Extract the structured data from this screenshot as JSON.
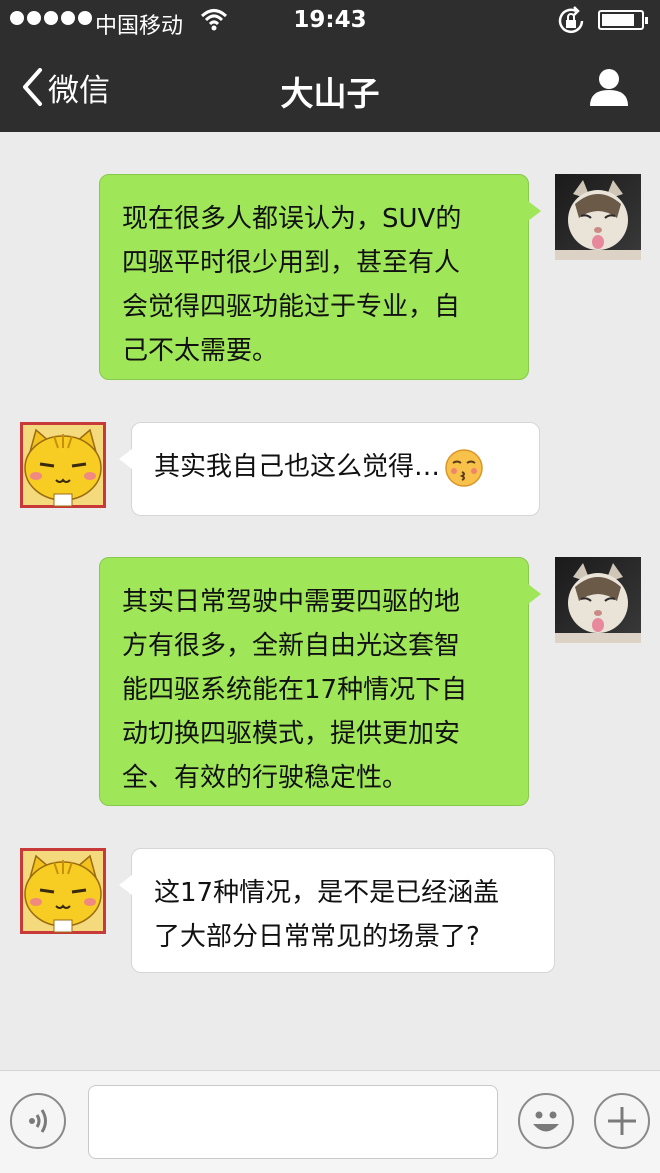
{
  "status_bar": {
    "carrier": "中国移动",
    "time": "19:43",
    "icons": [
      "signal-dots",
      "wifi-icon",
      "rotation-lock-icon",
      "battery-icon"
    ]
  },
  "nav": {
    "back_label": "微信",
    "title": "大山子",
    "right_icon": "profile-icon"
  },
  "messages": [
    {
      "sender": "me",
      "lines": [
        "现在很多人都误认为，SUV的",
        "四驱平时很少用到，甚至有人",
        "会觉得四驱功能过于专业，自",
        "己不太需要。"
      ],
      "avatar": "cat-photo"
    },
    {
      "sender": "other",
      "lines": [
        "其实我自己也这么觉得…"
      ],
      "emoji": "kissing-face-emoji",
      "avatar": "yellow-cartoon-cat"
    },
    {
      "sender": "me",
      "lines": [
        "其实日常驾驶中需要四驱的地",
        "方有很多，全新自由光这套智",
        "能四驱系统能在17种情况下自",
        "动切换四驱模式，提供更加安",
        "全、有效的行驶稳定性。"
      ],
      "avatar": "cat-photo"
    },
    {
      "sender": "other",
      "lines": [
        "这17种情况，是不是已经涵盖",
        "了大部分日常常见的场景了?"
      ],
      "avatar": "yellow-cartoon-cat"
    }
  ],
  "input_bar": {
    "voice_icon": "voice-icon",
    "text_value": "",
    "emoji_icon": "emoji-icon",
    "plus_icon": "plus-icon"
  },
  "colors": {
    "nav_bg": "#2e2e2e",
    "chat_bg": "#ebebeb",
    "sent_bubble": "#9fe658",
    "received_bubble": "#ffffff"
  }
}
